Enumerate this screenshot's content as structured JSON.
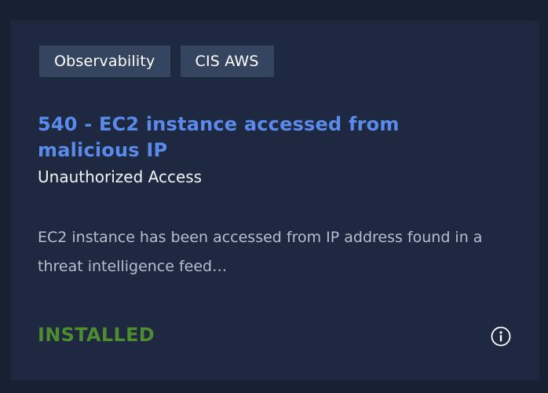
{
  "card": {
    "tags": [
      "Observability",
      "CIS AWS"
    ],
    "title": "540 - EC2 instance accessed from malicious IP",
    "subtitle": "Unauthorized Access",
    "description": "EC2 instance has been accessed from IP address found in a threat intelligence feed…",
    "status": "INSTALLED",
    "info_icon": "info-circle-icon"
  },
  "colors": {
    "page_background": "#182033",
    "card_background": "#1e2840",
    "tag_background": "#35445f",
    "title_accent": "#5b8bea",
    "status_installed": "#4d8c2f"
  }
}
